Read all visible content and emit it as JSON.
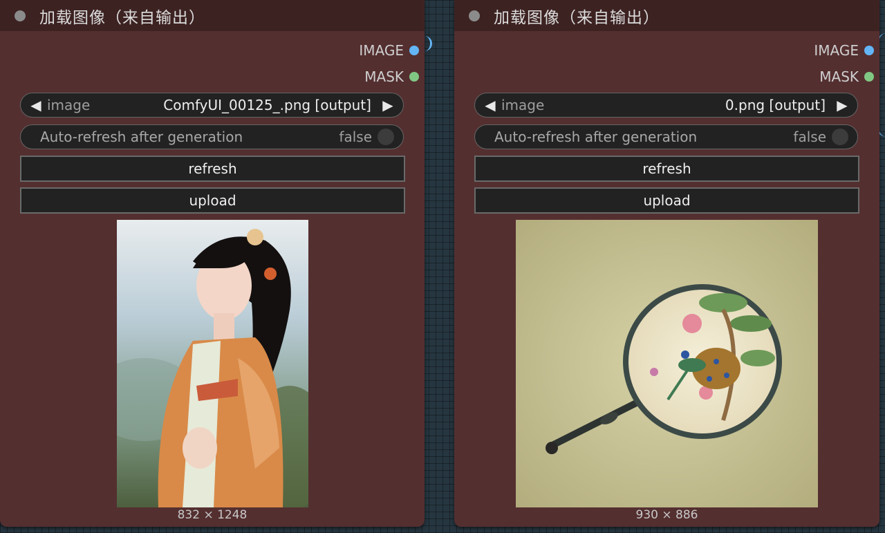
{
  "nodes": [
    {
      "title": "加载图像（来自输出）",
      "outputs": {
        "image": "IMAGE",
        "mask": "MASK"
      },
      "combo": {
        "name": "image",
        "value": "ComfyUI_00125_.png [output]"
      },
      "toggle": {
        "name": "Auto-refresh after generation",
        "value": "false"
      },
      "buttons": {
        "refresh": "refresh",
        "upload": "upload"
      },
      "preview_dims": "832 × 1248"
    },
    {
      "title": "加载图像（来自输出）",
      "outputs": {
        "image": "IMAGE",
        "mask": "MASK"
      },
      "combo": {
        "name": "image",
        "value": "0.png [output]"
      },
      "toggle": {
        "name": "Auto-refresh after generation",
        "value": "false"
      },
      "buttons": {
        "refresh": "refresh",
        "upload": "upload"
      },
      "preview_dims": "930 × 886"
    }
  ],
  "colors": {
    "node_bg": "#542f30",
    "title_bg": "#3d2222",
    "canvas_bg": "#263640",
    "image_socket": "#64b5f6",
    "mask_socket": "#81c784"
  }
}
